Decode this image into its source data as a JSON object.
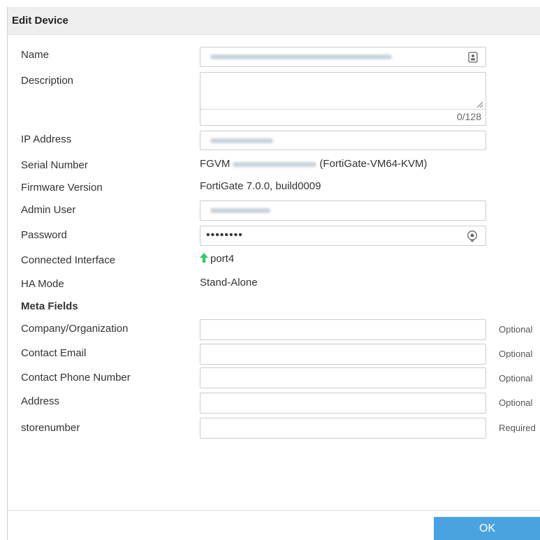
{
  "dialog": {
    "title": "Edit Device",
    "ok_label": "OK"
  },
  "fields": {
    "name": {
      "label": "Name"
    },
    "description": {
      "label": "Description",
      "counter": "0/128"
    },
    "ip_address": {
      "label": "IP Address"
    },
    "serial_number": {
      "label": "Serial Number",
      "prefix": "FGVM",
      "model": "(FortiGate-VM64-KVM)"
    },
    "firmware_version": {
      "label": "Firmware Version",
      "value": "FortiGate 7.0.0, build0009"
    },
    "admin_user": {
      "label": "Admin User"
    },
    "password": {
      "label": "Password",
      "value": "••••••••"
    },
    "connected_interface": {
      "label": "Connected Interface",
      "value": "port4"
    },
    "ha_mode": {
      "label": "HA Mode",
      "value": "Stand-Alone"
    }
  },
  "meta_fields": {
    "heading": "Meta Fields",
    "items": [
      {
        "label": "Company/Organization",
        "hint": "Optional"
      },
      {
        "label": "Contact Email",
        "hint": "Optional"
      },
      {
        "label": "Contact Phone Number",
        "hint": "Optional"
      },
      {
        "label": "Address",
        "hint": "Optional"
      },
      {
        "label": "storenumber",
        "hint": "Required"
      }
    ]
  },
  "colors": {
    "accent": "#4aa3e0",
    "status_up": "#2ecc71"
  }
}
